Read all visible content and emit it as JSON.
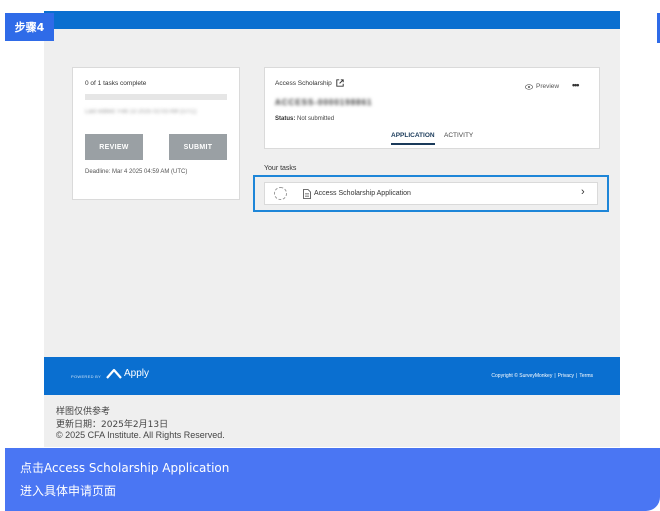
{
  "step_badge": "步骤4",
  "left_card": {
    "tasks_complete": "0 of 1 tasks complete",
    "progress": 0,
    "last_edited": "Last edited: Feb 13 2025 02:03 AM (UTC)",
    "review_label": "REVIEW",
    "submit_label": "SUBMIT",
    "deadline": "Deadline: Mar 4 2025 04:59 AM (UTC)"
  },
  "app_card": {
    "title": "Access Scholarship",
    "preview_label": "Preview",
    "more_label": "•••",
    "app_id": "ACCESS-0000198861",
    "status_label": "Status:",
    "status_value": "Not submitted",
    "tabs": [
      "APPLICATION",
      "ACTIVITY"
    ]
  },
  "your_tasks_label": "Your tasks",
  "task": {
    "label": "Access Scholarship Application",
    "chevron": "›"
  },
  "footer": {
    "powered_by": "POWERED BY",
    "apply_text": "Apply",
    "copyright": "Copyright © SurveyMonkey",
    "sep": "|",
    "privacy": "Privacy",
    "terms": "Terms"
  },
  "note": {
    "line1": "样图仅供参考",
    "line2": "更新日期：2025年2月13日",
    "line3": "© 2025 CFA Institute. All Rights Reserved."
  },
  "caption": {
    "line1": "点击Access Scholarship Application",
    "line2": "进入具体申请页面"
  },
  "colors": {
    "brand_blue": "#0a6fd0",
    "badge_blue": "#2f6be8",
    "caption_blue": "#4a76f3",
    "highlight_border": "#1e86d8",
    "button_grey": "#9aa0a4"
  }
}
